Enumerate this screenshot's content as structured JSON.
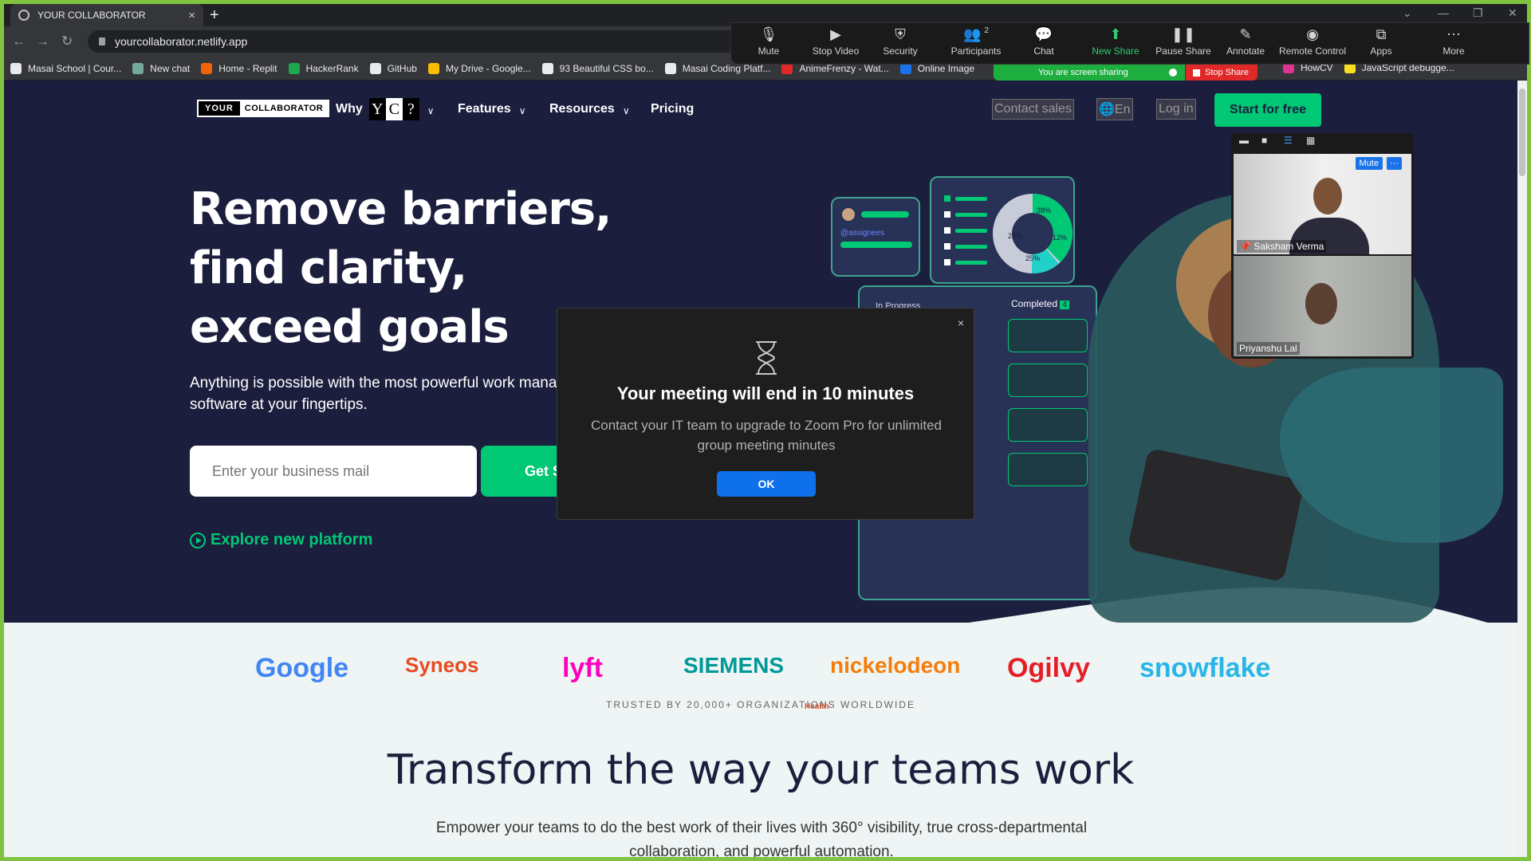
{
  "browser": {
    "tab_title": "YOUR COLLABORATOR",
    "new_tab": "+",
    "url": "yourcollaborator.netlify.app",
    "bookmarks": [
      {
        "label": "Masai School | Cour...",
        "color": "#e8eaed"
      },
      {
        "label": "New chat",
        "color": "#74aa9c"
      },
      {
        "label": "Home - Replit",
        "color": "#f26207"
      },
      {
        "label": "HackerRank",
        "color": "#1ba94c"
      },
      {
        "label": "GitHub",
        "color": "#e8eaed"
      },
      {
        "label": "My Drive - Google...",
        "color": "#fbbc04"
      },
      {
        "label": "93 Beautiful CSS bo...",
        "color": "#e8eaed"
      },
      {
        "label": "Masai Coding Platf...",
        "color": "#e8eaed"
      },
      {
        "label": "AnimeFrenzy - Wat...",
        "color": "#e02828"
      },
      {
        "label": "Online Image",
        "color": "#1a73e8"
      }
    ],
    "bookmarks_more": [
      {
        "label": "HowCV",
        "color": "#e0338f"
      },
      {
        "label": "JavaScript debugge...",
        "color": "#f7df1e"
      }
    ]
  },
  "site": {
    "logo_left": "YOUR",
    "logo_right": "COLLABORATOR",
    "nav": {
      "why": "Why",
      "yc_letters": [
        "Y",
        "C",
        "?"
      ],
      "features": "Features",
      "resources": "Resources",
      "pricing": "Pricing",
      "contact_sales": "Contact sales",
      "language": "En",
      "login": "Log in",
      "start": "Start for free"
    },
    "hero_title_lines": [
      "Remove barriers,",
      "find clarity,",
      "exceed goals"
    ],
    "hero_sub": "Anything is possible with the most powerful work management software at your fingertips.",
    "email_placeholder": "Enter your business mail",
    "get_started": "Get Started",
    "explore": "Explore new platform",
    "illustration": {
      "assignees": "@assignees",
      "pie_labels": [
        "38%",
        "25%",
        "12%",
        "25%"
      ],
      "in_progress": "In Progress",
      "completed": "Completed",
      "completed_count": "4"
    },
    "companies": [
      {
        "name": "Google",
        "color": "#4285f4"
      },
      {
        "name": "Syneos",
        "color": "#e84c22"
      },
      {
        "name": "lyft",
        "color": "#ff00bf"
      },
      {
        "name": "SIEMENS",
        "color": "#009999"
      },
      {
        "name": "nickelodeon",
        "color": "#f57d0d"
      },
      {
        "name": "Ogilvy",
        "color": "#e61e27"
      },
      {
        "name": "snowflake",
        "color": "#29b5e8"
      }
    ],
    "syneos_sub": "Health",
    "trusted": "TRUSTED BY 20,000+ ORGANIZATIONS WORLDWIDE",
    "section_title": "Transform the way your teams work",
    "section_text": "Empower your teams to do the best work of their lives with 360° visibility, true cross-departmental collaboration, and powerful automation."
  },
  "zoom": {
    "toolbar": [
      {
        "label": "Mute",
        "icon": "microphone-icon"
      },
      {
        "label": "Stop Video",
        "icon": "video-camera-icon"
      },
      {
        "label": "Security",
        "icon": "shield-icon"
      },
      {
        "label": "Participants",
        "icon": "participants-icon",
        "badge": "2"
      },
      {
        "label": "Chat",
        "icon": "chat-icon"
      },
      {
        "label": "New Share",
        "icon": "share-screen-icon"
      },
      {
        "label": "Pause Share",
        "icon": "pause-icon"
      },
      {
        "label": "Annotate",
        "icon": "pencil-icon"
      },
      {
        "label": "Remote Control",
        "icon": "mouse-icon"
      },
      {
        "label": "Apps",
        "icon": "apps-icon"
      },
      {
        "label": "More",
        "icon": "more-icon"
      }
    ],
    "sharing_status": "You are screen sharing",
    "stop_share": "Stop Share",
    "participants": [
      {
        "name": "Saksham Verma",
        "mute_label": "Mute",
        "more_label": "···"
      },
      {
        "name": "Priyanshu Lal"
      }
    ],
    "modal": {
      "title": "Your meeting will end in 10 minutes",
      "message": "Contact your IT team to upgrade to Zoom Pro for unlimited group meeting minutes",
      "ok": "OK",
      "close": "×"
    }
  }
}
